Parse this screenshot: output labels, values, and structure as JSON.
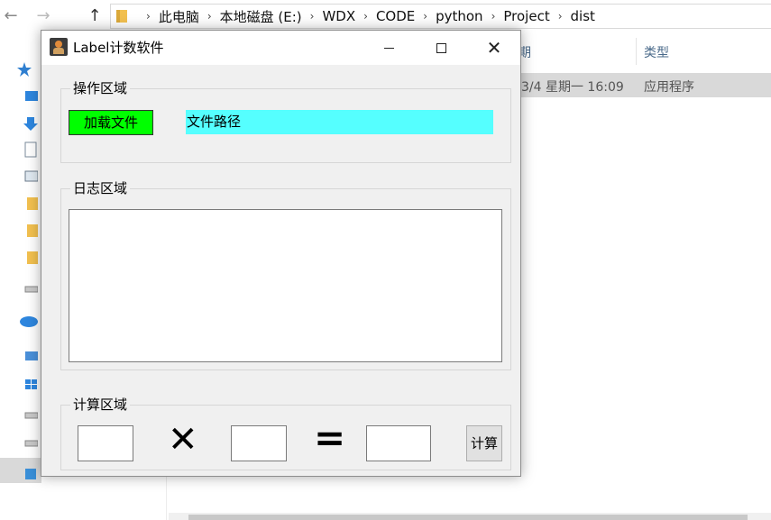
{
  "explorer": {
    "breadcrumbs": [
      "此电脑",
      "本地磁盘 (E:)",
      "WDX",
      "CODE",
      "python",
      "Project",
      "dist"
    ],
    "columns": {
      "date_partial": "期",
      "type": "类型"
    },
    "file_row": {
      "date": "3/4 星期一 16:09",
      "type": "应用程序"
    }
  },
  "window": {
    "title": "Label计数软件",
    "operation_group": {
      "label": "操作区域",
      "load_button": "加载文件",
      "path_text": "文件路径"
    },
    "log_group": {
      "label": "日志区域"
    },
    "calc_group": {
      "label": "计算区域",
      "times_symbol": "✕",
      "equals_symbol": "=",
      "calc_button": "计算"
    }
  },
  "colors": {
    "load_button_bg": "#00ff00",
    "path_label_bg": "#55ffff"
  }
}
